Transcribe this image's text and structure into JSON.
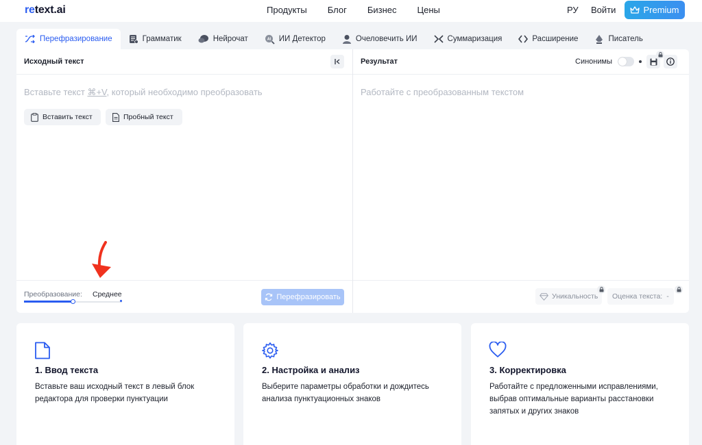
{
  "header": {
    "logo_prefix": "re",
    "logo_rest": "text.ai",
    "nav": [
      "Продукты",
      "Блог",
      "Бизнес",
      "Цены"
    ],
    "lang": "РУ",
    "login": "Войти",
    "premium": "Premium"
  },
  "tabs": [
    {
      "label": "Перефразирование",
      "icon": "paraphrase-icon",
      "active": true
    },
    {
      "label": "Грамматик",
      "icon": "grammar-icon",
      "active": false
    },
    {
      "label": "Нейрочат",
      "icon": "chat-icon",
      "active": false
    },
    {
      "label": "ИИ Детектор",
      "icon": "ai-detector-icon",
      "active": false
    },
    {
      "label": "Очеловечить ИИ",
      "icon": "humanize-icon",
      "active": false
    },
    {
      "label": "Суммаризация",
      "icon": "summarize-icon",
      "active": false
    },
    {
      "label": "Расширение",
      "icon": "expand-icon",
      "active": false
    },
    {
      "label": "Писатель",
      "icon": "writer-icon",
      "active": false
    }
  ],
  "source": {
    "title": "Исходный текст",
    "placeholder_before": "Вставьте текст ",
    "placeholder_kbd": "⌘+V",
    "placeholder_after": ", который необходимо преобразовать",
    "paste_button": "Вставить текст",
    "sample_button": "Пробный текст",
    "mode_label": "Преобразование:",
    "mode_value": "Среднее",
    "mode_level": 0.5,
    "action_button": "Перефразировать"
  },
  "result": {
    "title": "Результат",
    "synonyms_label": "Синонимы",
    "synonyms_on": false,
    "placeholder": "Работайте с преобразованным текстом",
    "uniqueness_label": "Уникальность",
    "score_label": "Оценка текста:",
    "score_value": "-"
  },
  "cards": [
    {
      "title": "1. Ввод текста",
      "text": "Вставьте ваш исходный текст в левый блок редактора для проверки пунктуации",
      "icon": "document-icon"
    },
    {
      "title": "2. Настройка и анализ",
      "text": "Выберите параметры обработки и дождитесь анализа пунктуационных знаков",
      "icon": "gear-icon"
    },
    {
      "title": "3. Корректировка",
      "text": "Работайте с предложенными исправлениями, выбрав оптимальные варианты расстановки запятых и других знаков",
      "icon": "heart-icon"
    }
  ],
  "colors": {
    "accent": "#2a5cf0",
    "premium": "#2aa6e8",
    "arrow": "#f0321e"
  }
}
